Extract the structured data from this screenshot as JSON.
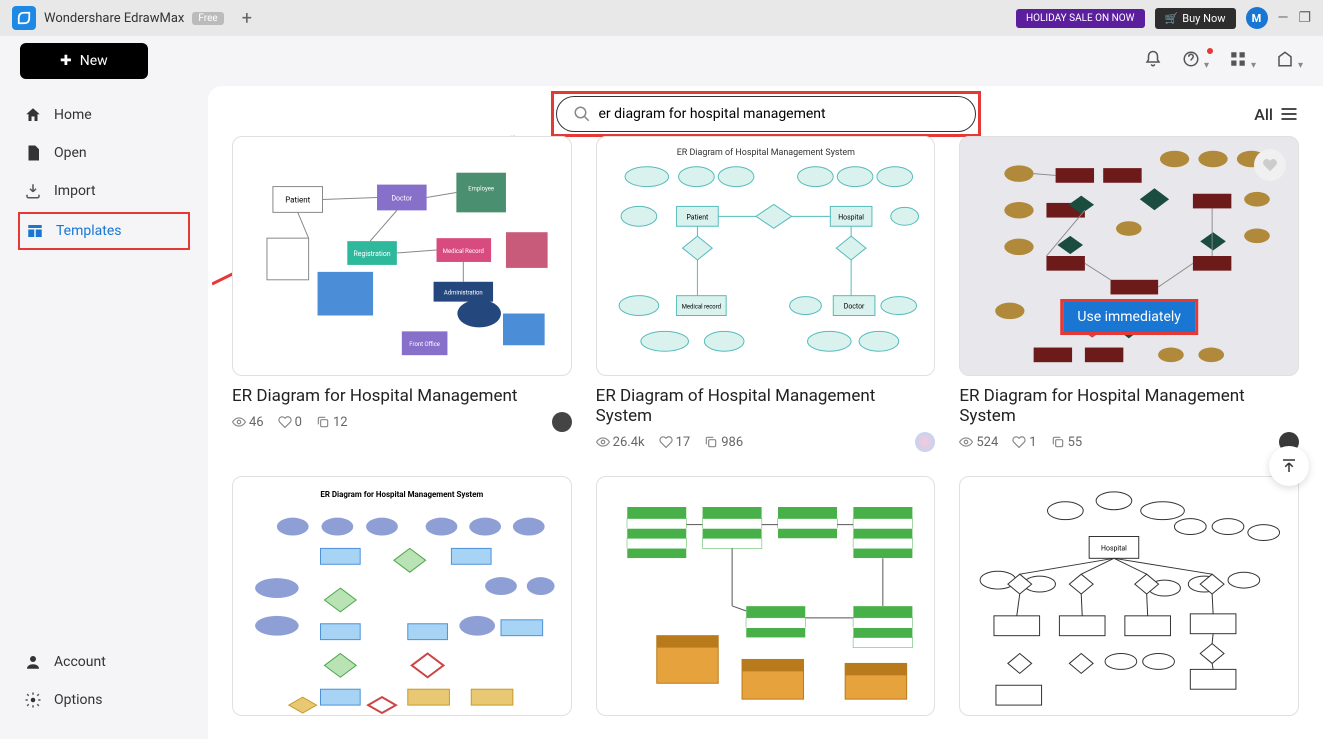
{
  "titlebar": {
    "app_name": "Wondershare EdrawMax",
    "badge": "Free",
    "promo": "HOLIDAY SALE ON NOW",
    "buy": "Buy Now",
    "avatar_letter": "M"
  },
  "toolbar": {
    "new_label": "New"
  },
  "sidebar": {
    "items": [
      {
        "label": "Home",
        "icon": "home"
      },
      {
        "label": "Open",
        "icon": "file"
      },
      {
        "label": "Import",
        "icon": "import"
      },
      {
        "label": "Templates",
        "icon": "templates",
        "active": true
      }
    ],
    "bottom": [
      {
        "label": "Account",
        "icon": "account"
      },
      {
        "label": "Options",
        "icon": "gear"
      }
    ]
  },
  "search": {
    "value": "er diagram for hospital management",
    "filter_label": "All"
  },
  "cards": [
    {
      "title": "ER Diagram for Hospital Management",
      "views": "46",
      "likes": "0",
      "copies": "12",
      "author": "a1"
    },
    {
      "title": "ER Diagram of Hospital Management System",
      "views": "26.4k",
      "likes": "17",
      "copies": "986",
      "author": "a2"
    },
    {
      "title": "ER Diagram for Hospital Management System",
      "views": "524",
      "likes": "1",
      "copies": "55",
      "author": "a3",
      "hovered": true,
      "use_label": "Use immediately"
    },
    {
      "title": "",
      "views": "",
      "likes": "",
      "copies": ""
    },
    {
      "title": "",
      "views": "",
      "likes": "",
      "copies": ""
    },
    {
      "title": "",
      "views": "",
      "likes": "",
      "copies": ""
    }
  ]
}
